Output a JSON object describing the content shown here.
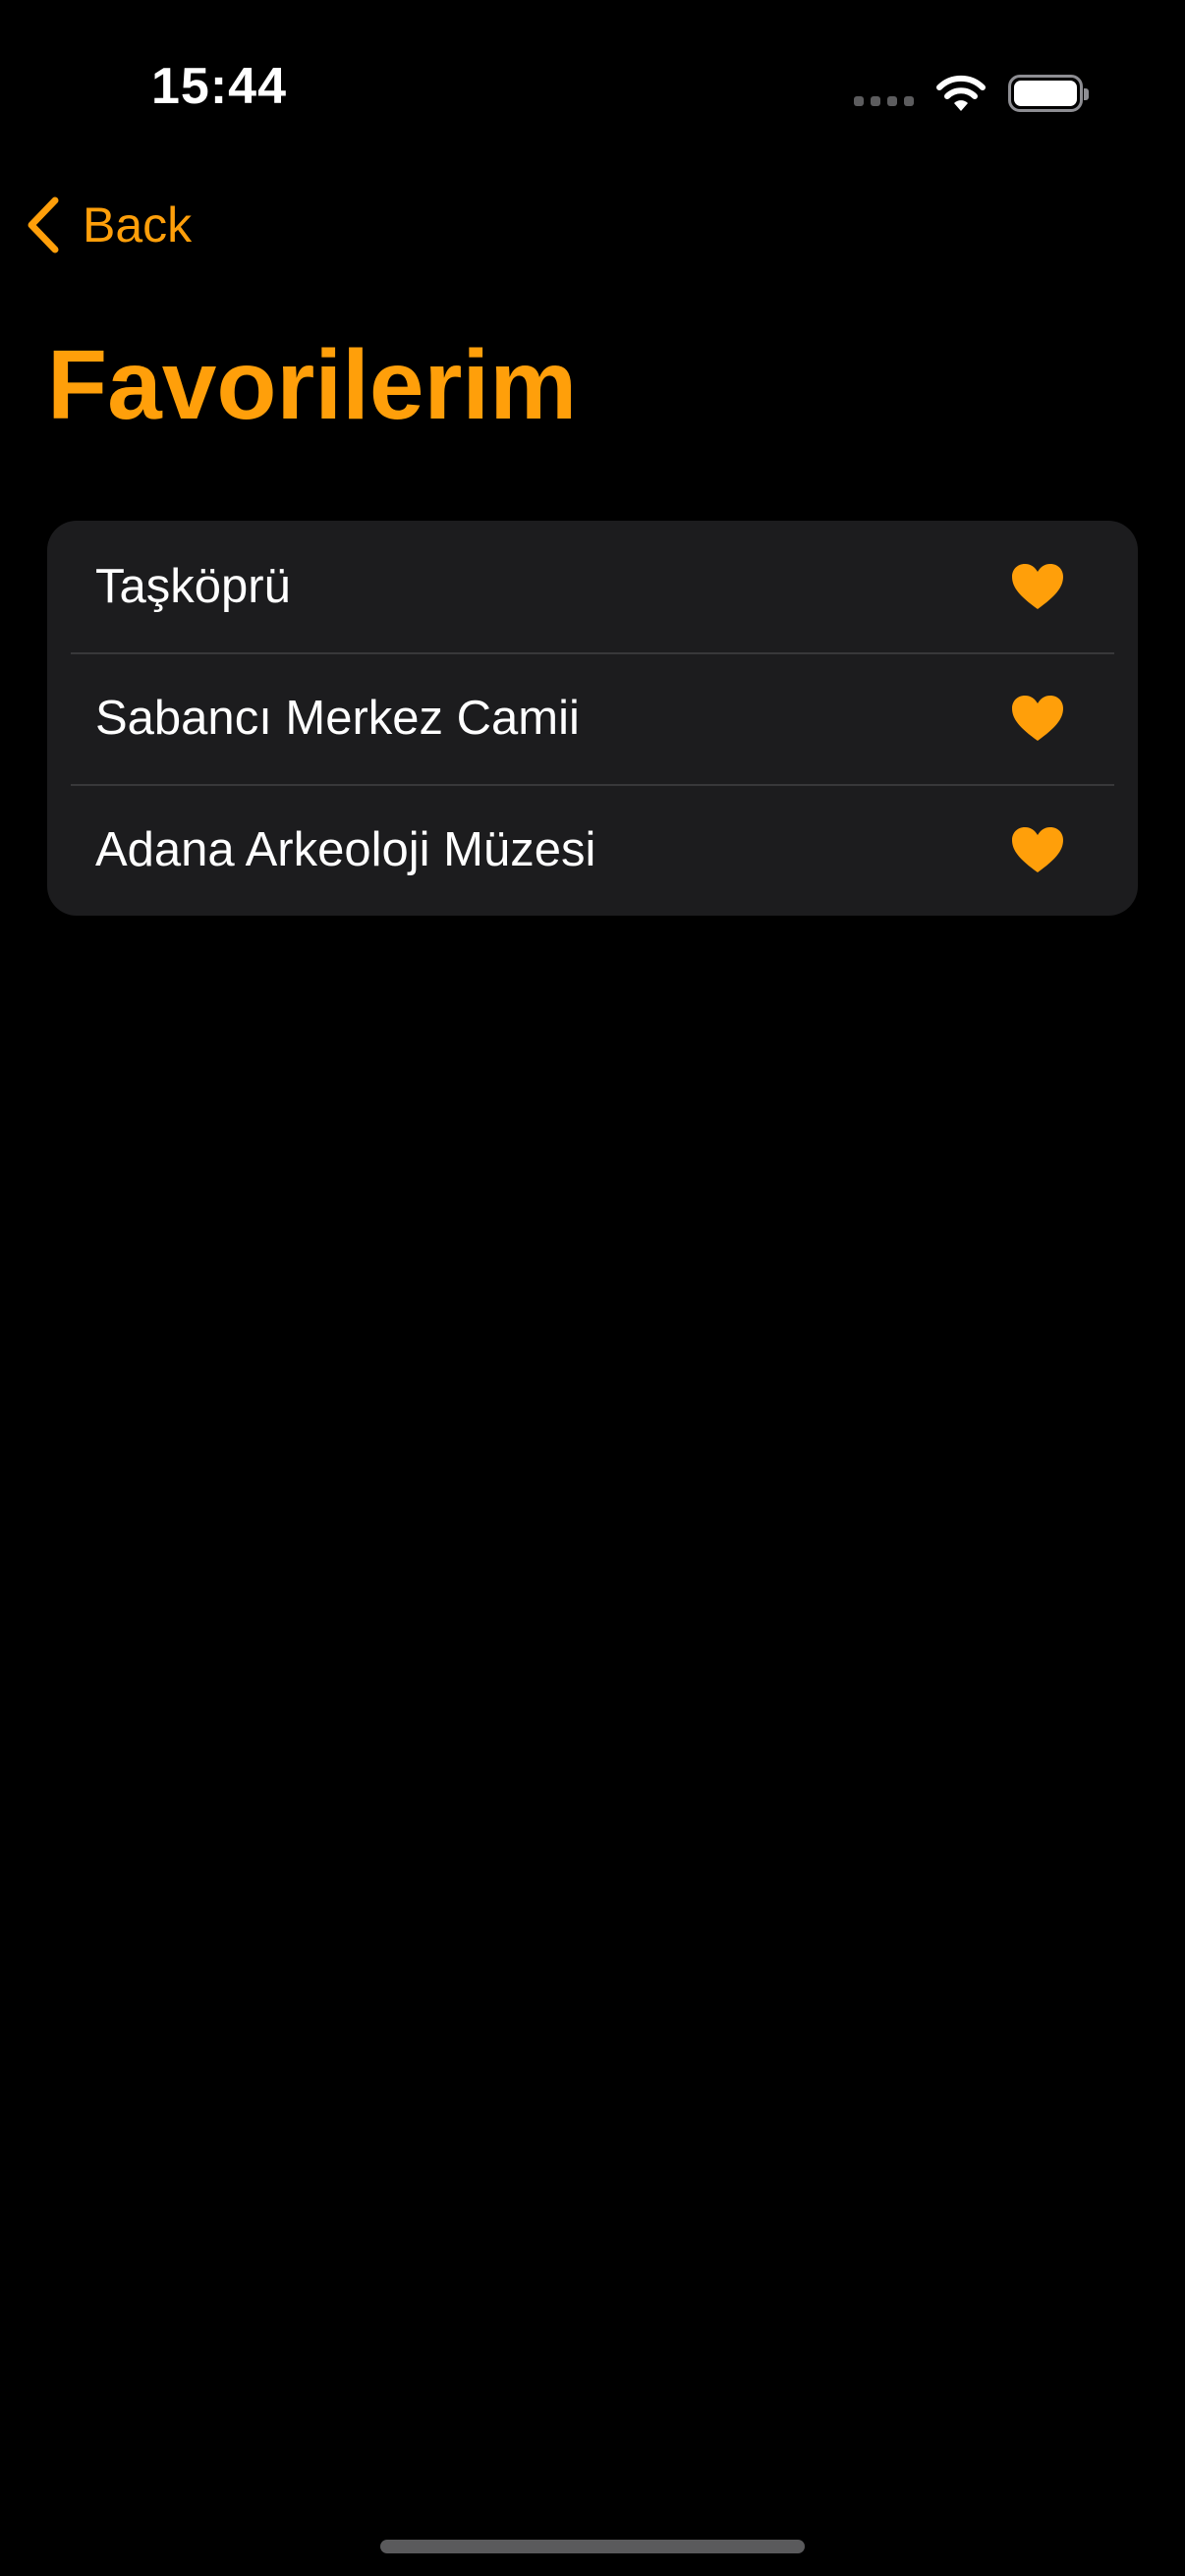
{
  "status_bar": {
    "time": "15:44",
    "wifi_icon": "wifi-icon",
    "battery_icon": "battery-icon"
  },
  "navigation": {
    "back_label": "Back",
    "back_icon": "chevron-left-icon"
  },
  "page": {
    "title": "Favorilerim"
  },
  "favorites": [
    {
      "name": "Taşköprü",
      "icon": "heart-icon"
    },
    {
      "name": "Sabancı Merkez Camii",
      "icon": "heart-icon"
    },
    {
      "name": "Adana Arkeoloji Müzesi",
      "icon": "heart-icon"
    }
  ],
  "colors": {
    "accent": "#ff9f0a",
    "background": "#000000",
    "list_background": "#1c1c1e",
    "separator": "#38383a",
    "text": "#ffffff"
  }
}
